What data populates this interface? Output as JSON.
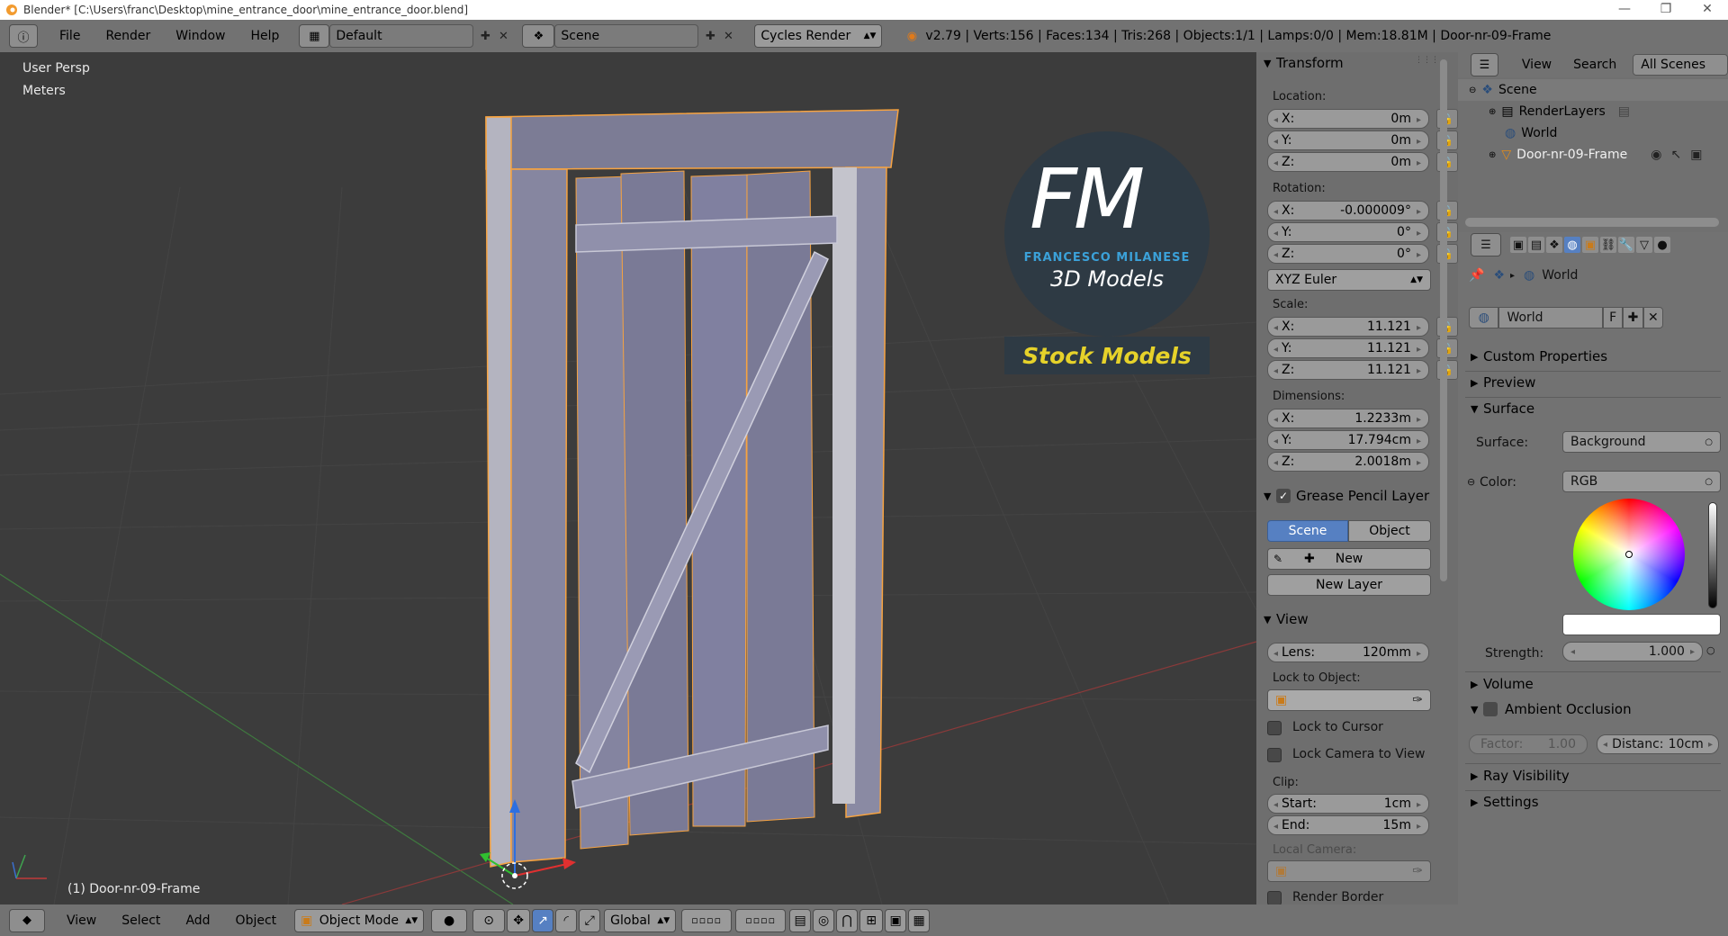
{
  "window": {
    "title": "Blender* [C:\\Users\\franc\\Desktop\\mine_entrance_door\\mine_entrance_door.blend]",
    "buttons": [
      "—",
      "❐",
      "✕"
    ]
  },
  "info_header": {
    "menus": [
      "File",
      "Render",
      "Window",
      "Help"
    ],
    "screen_layout": "Default",
    "scene": "Scene",
    "render_engine": "Cycles Render",
    "stats": "v2.79 | Verts:156 | Faces:134 | Tris:268 | Objects:1/1 | Lamps:0/0 | Mem:18.81M | Door-nr-09-Frame"
  },
  "viewport": {
    "view_name": "User Persp",
    "units": "Meters",
    "object_label": "(1) Door-nr-09-Frame",
    "logo": {
      "letters": "FM",
      "name": "FRANCESCO MILANESE",
      "tagline": "3D Models",
      "badge": "Stock Models"
    }
  },
  "bottom_header": {
    "menus": [
      "View",
      "Select",
      "Add",
      "Object"
    ],
    "mode": "Object Mode",
    "orientation": "Global"
  },
  "n_panel": {
    "transform": {
      "title": "Transform",
      "location_label": "Location:",
      "location": [
        {
          "axis": "X:",
          "value": "0m"
        },
        {
          "axis": "Y:",
          "value": "0m"
        },
        {
          "axis": "Z:",
          "value": "0m"
        }
      ],
      "rotation_label": "Rotation:",
      "rotation": [
        {
          "axis": "X:",
          "value": "-0.000009°"
        },
        {
          "axis": "Y:",
          "value": "0°"
        },
        {
          "axis": "Z:",
          "value": "0°"
        }
      ],
      "rotation_mode": "XYZ Euler",
      "scale_label": "Scale:",
      "scale": [
        {
          "axis": "X:",
          "value": "11.121"
        },
        {
          "axis": "Y:",
          "value": "11.121"
        },
        {
          "axis": "Z:",
          "value": "11.121"
        }
      ],
      "dimensions_label": "Dimensions:",
      "dimensions": [
        {
          "axis": "X:",
          "value": "1.2233m"
        },
        {
          "axis": "Y:",
          "value": "17.794cm"
        },
        {
          "axis": "Z:",
          "value": "2.0018m"
        }
      ]
    },
    "grease_pencil": {
      "title": "Grease Pencil Layer",
      "tab_scene": "Scene",
      "tab_object": "Object",
      "new_label": "New",
      "new_layer_label": "New Layer"
    },
    "view": {
      "title": "View",
      "lens_label": "Lens:",
      "lens_value": "120mm",
      "lock_to_object_label": "Lock to Object:",
      "lock_to_cursor": "Lock to Cursor",
      "lock_camera_to_view": "Lock Camera to View",
      "clip_label": "Clip:",
      "clip_start_label": "Start:",
      "clip_start_value": "1cm",
      "clip_end_label": "End:",
      "clip_end_value": "15m",
      "local_camera_label": "Local Camera:",
      "render_border": "Render Border"
    }
  },
  "outliner": {
    "menus": [
      "View",
      "Search"
    ],
    "filter": "All Scenes",
    "items": [
      {
        "label": "Scene",
        "indent": 0
      },
      {
        "label": "RenderLayers",
        "indent": 1
      },
      {
        "label": "World",
        "indent": 1
      },
      {
        "label": "Door-nr-09-Frame",
        "indent": 1
      }
    ]
  },
  "properties": {
    "breadcrumb": "World",
    "world_name": "World",
    "world_fake_user": "F",
    "panels": {
      "custom_properties": "Custom Properties",
      "preview": "Preview",
      "surface": "Surface",
      "volume": "Volume",
      "ambient_occlusion": "Ambient Occlusion",
      "ray_visibility": "Ray Visibility",
      "settings": "Settings"
    },
    "surface_label": "Surface:",
    "surface_value": "Background",
    "color_label": "Color:",
    "color_mode": "RGB",
    "strength_label": "Strength:",
    "strength_value": "1.000",
    "ao_factor_label": "Factor:",
    "ao_factor_value": "1.00",
    "ao_distance_label": "Distanc:",
    "ao_distance_value": "10cm"
  },
  "colors": {
    "accent_blue": "#5680c2",
    "selection_orange": "#f7a340",
    "header_grey": "#727272"
  }
}
